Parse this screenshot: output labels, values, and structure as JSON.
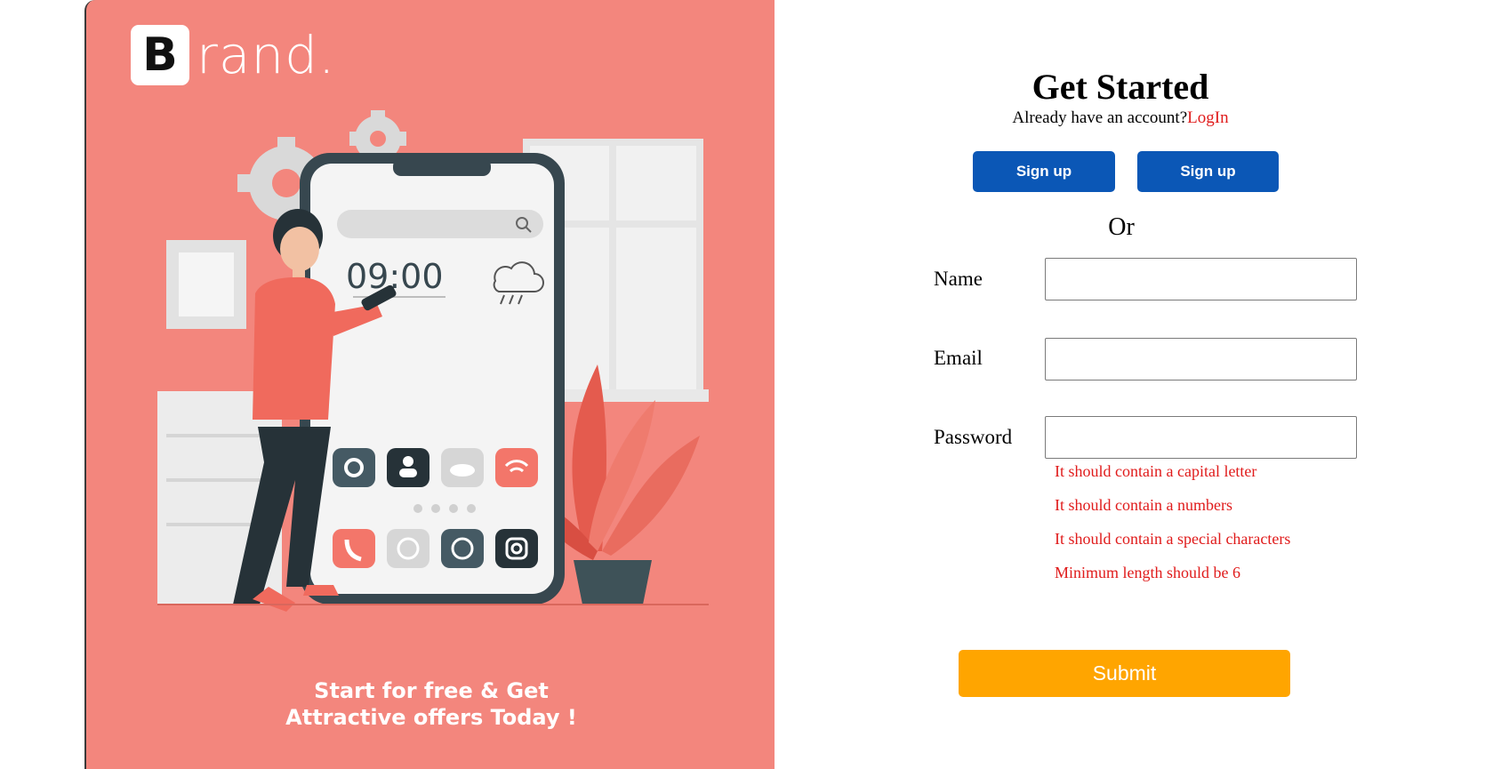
{
  "brand": {
    "letter": "B",
    "rest": "rand."
  },
  "promo": {
    "line1": "Start for free & Get",
    "line2": "Attractive offers Today !"
  },
  "phone": {
    "time": "09:00"
  },
  "header": {
    "title": "Get Started",
    "subtitle": "Already have an account?",
    "login_link": "LogIn"
  },
  "social": {
    "button1": "Sign up",
    "button2": "Sign up"
  },
  "or_text": "Or",
  "form": {
    "name_label": "Name",
    "email_label": "Email",
    "password_label": "Password",
    "name_value": "",
    "email_value": "",
    "password_value": "",
    "errors": [
      "It should contain a capital letter",
      "It should contain a numbers",
      "It should contain a special characters",
      "Minimum length should be 6"
    ],
    "submit_label": "Submit"
  },
  "colors": {
    "promo_bg": "#f3867d",
    "signup_btn": "#0b57b6",
    "submit_btn": "#ffa500",
    "error_text": "#e01b1b"
  }
}
